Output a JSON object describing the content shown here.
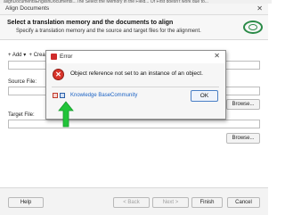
{
  "top_cut_text": "alignDocumentsEnglishDocuments...The  Select the Memory in the Field... Of  First doesn't work due to...",
  "window": {
    "title": "Align Documents",
    "close": "✕"
  },
  "header": {
    "title": "Select a translation memory and the documents to align",
    "subtitle": "Specify a translation memory and the source and target files for the alignment."
  },
  "toolbar": {
    "add": "+ Add",
    "add_chevron": "▾",
    "create": "+ Crea"
  },
  "source": {
    "label": "Source File:",
    "browse": "Browse..."
  },
  "target": {
    "label": "Target File:",
    "browse": "Browse..."
  },
  "footer": {
    "help": "Help",
    "back": "< Back",
    "next": "Next >",
    "finish": "Finish",
    "cancel": "Cancel"
  },
  "dialog": {
    "title": "Error",
    "close": "✕",
    "error_glyph": "✕",
    "message": "Object reference not set to an instance of an object.",
    "ok": "OK",
    "links": [
      "Knowledge Base",
      "Community"
    ]
  },
  "colors": {
    "arrow": "#22c43a",
    "error": "#d9342b",
    "link": "#1b62c4",
    "logo": "#2a8a47"
  },
  "icons": [
    "close-icon",
    "error-icon",
    "trados-logo-icon",
    "pdf-icon",
    "save-icon",
    "arrow-annotation-icon"
  ]
}
